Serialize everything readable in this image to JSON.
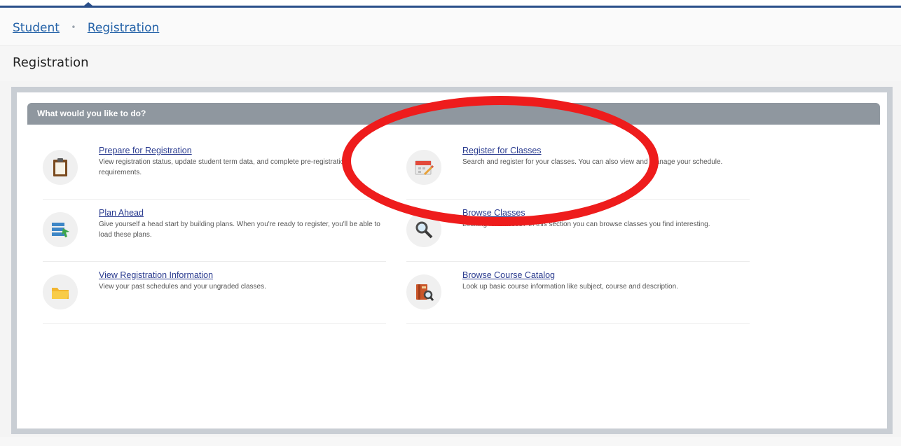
{
  "breadcrumb": {
    "root": "Student",
    "current": "Registration",
    "separator": "•"
  },
  "page": {
    "title": "Registration"
  },
  "panel": {
    "header": "What would you like to do?"
  },
  "actions": [
    {
      "title": "Prepare for Registration",
      "description": "View registration status, update student term data, and complete pre-registration requirements.",
      "icon": "clipboard-icon"
    },
    {
      "title": "Register for Classes",
      "description": "Search and register for your classes. You can also view and manage your schedule.",
      "icon": "calendar-edit-icon"
    },
    {
      "title": "Plan Ahead",
      "description": "Give yourself a head start by building plans. When you're ready to register, you'll be able to load these plans.",
      "icon": "plan-list-icon"
    },
    {
      "title": "Browse Classes",
      "description": "Looking for classes? In this section you can browse classes you find interesting.",
      "icon": "magnifier-icon"
    },
    {
      "title": "View Registration Information",
      "description": "View your past schedules and your ungraded classes.",
      "icon": "folder-icon"
    },
    {
      "title": "Browse Course Catalog",
      "description": "Look up basic course information like subject, course and description.",
      "icon": "catalog-book-icon"
    }
  ],
  "colors": {
    "accent_bar": "#2a4f8a",
    "link": "#2a3b8f",
    "panel_header": "#8f979f",
    "highlight": "#ee1c1c"
  }
}
